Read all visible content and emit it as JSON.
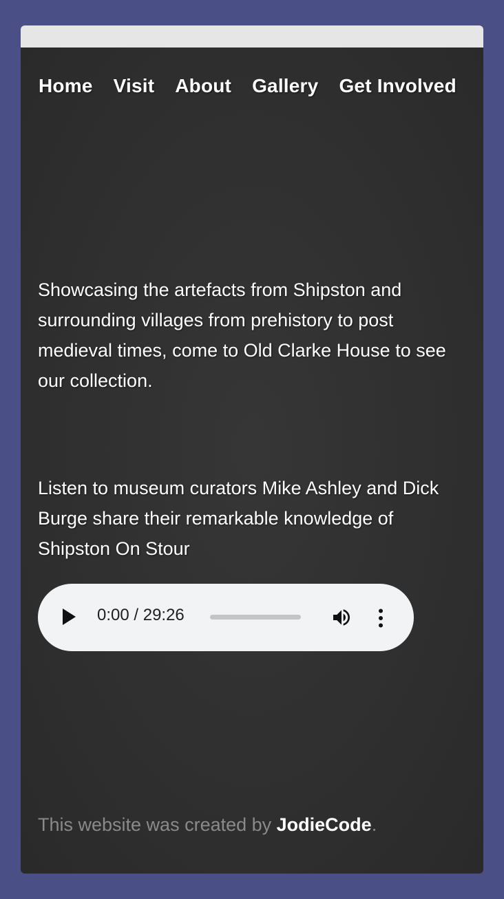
{
  "nav": {
    "items": [
      {
        "label": "Home"
      },
      {
        "label": "Visit"
      },
      {
        "label": "About"
      },
      {
        "label": "Gallery"
      },
      {
        "label": "Get Involved"
      }
    ]
  },
  "intro": {
    "text": "Showcasing the artefacts from Shipston and surrounding villages from prehistory to post medieval times, come to Old Clarke House to see our collection."
  },
  "listen": {
    "text": "Listen to museum curators Mike Ashley and Dick Burge share their remarkable knowledge of Shipston On Stour"
  },
  "audio": {
    "time": "0:00 / 29:26",
    "progress": 0,
    "icons": {
      "play": "play-icon",
      "volume": "volume-icon",
      "menu": "more-vert-icon"
    }
  },
  "footer": {
    "prefix": "This website was created by ",
    "brand": "JodieCode",
    "suffix": "."
  },
  "colors": {
    "background": "#4a5086",
    "panel": "#333333",
    "topbar": "#e6e6e6",
    "player": "#f1f3f4"
  }
}
